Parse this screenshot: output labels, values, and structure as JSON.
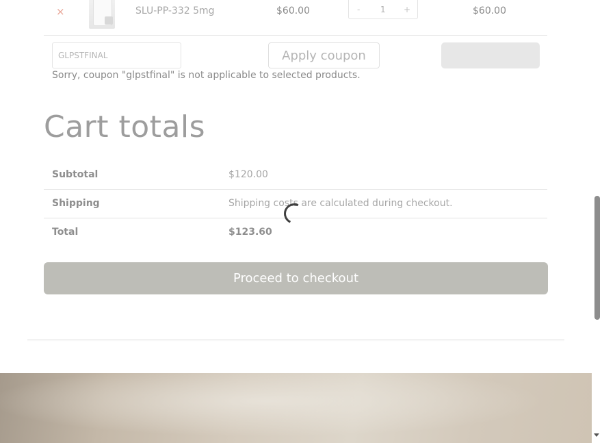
{
  "cart_item": {
    "remove_label": "×",
    "thumbnail_icon": "product-vial-image",
    "name": "SLU-PP-332 5mg",
    "price": "$60.00",
    "quantity_minus": "-",
    "quantity": "1",
    "quantity_plus": "+",
    "subtotal": "$60.00"
  },
  "coupon": {
    "placeholder": "GLPSTFINAL",
    "value": "GLPSTFINAL",
    "apply_label": "Apply coupon",
    "update_label": "",
    "error_message": "Sorry, coupon \"glpstfinal\" is not applicable to selected products."
  },
  "totals": {
    "title": "Cart totals",
    "rows": [
      {
        "label": "Subtotal",
        "value": "$120.00"
      },
      {
        "label": "Shipping",
        "value": "Shipping costs are calculated during checkout."
      },
      {
        "label": "Total",
        "value": "$123.60"
      }
    ],
    "checkout_label": "Proceed to checkout"
  },
  "colors": {
    "checkout_button": "#bdbdb7",
    "remove_icon": "#e8a394",
    "spinner": "#3f3f3f"
  }
}
